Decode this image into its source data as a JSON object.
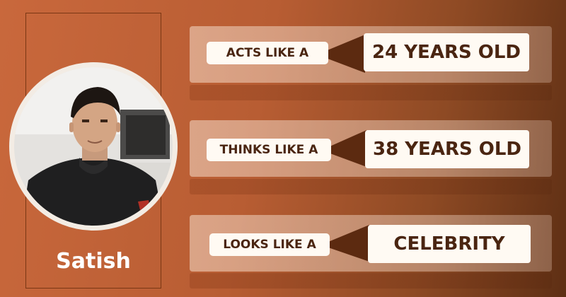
{
  "profile": {
    "name": "Satish"
  },
  "rows": [
    {
      "label": "ACTS LIKE A",
      "value": "24 YEARS OLD"
    },
    {
      "label": "THINKS LIKE A",
      "value": "38 YEARS OLD"
    },
    {
      "label": "LOOKS LIKE A",
      "value": "CELEBRITY"
    }
  ],
  "colors": {
    "background": "#b85d33",
    "text_dark": "#4a2511",
    "connector": "#5c2a10",
    "pill": "#fffaf3"
  }
}
